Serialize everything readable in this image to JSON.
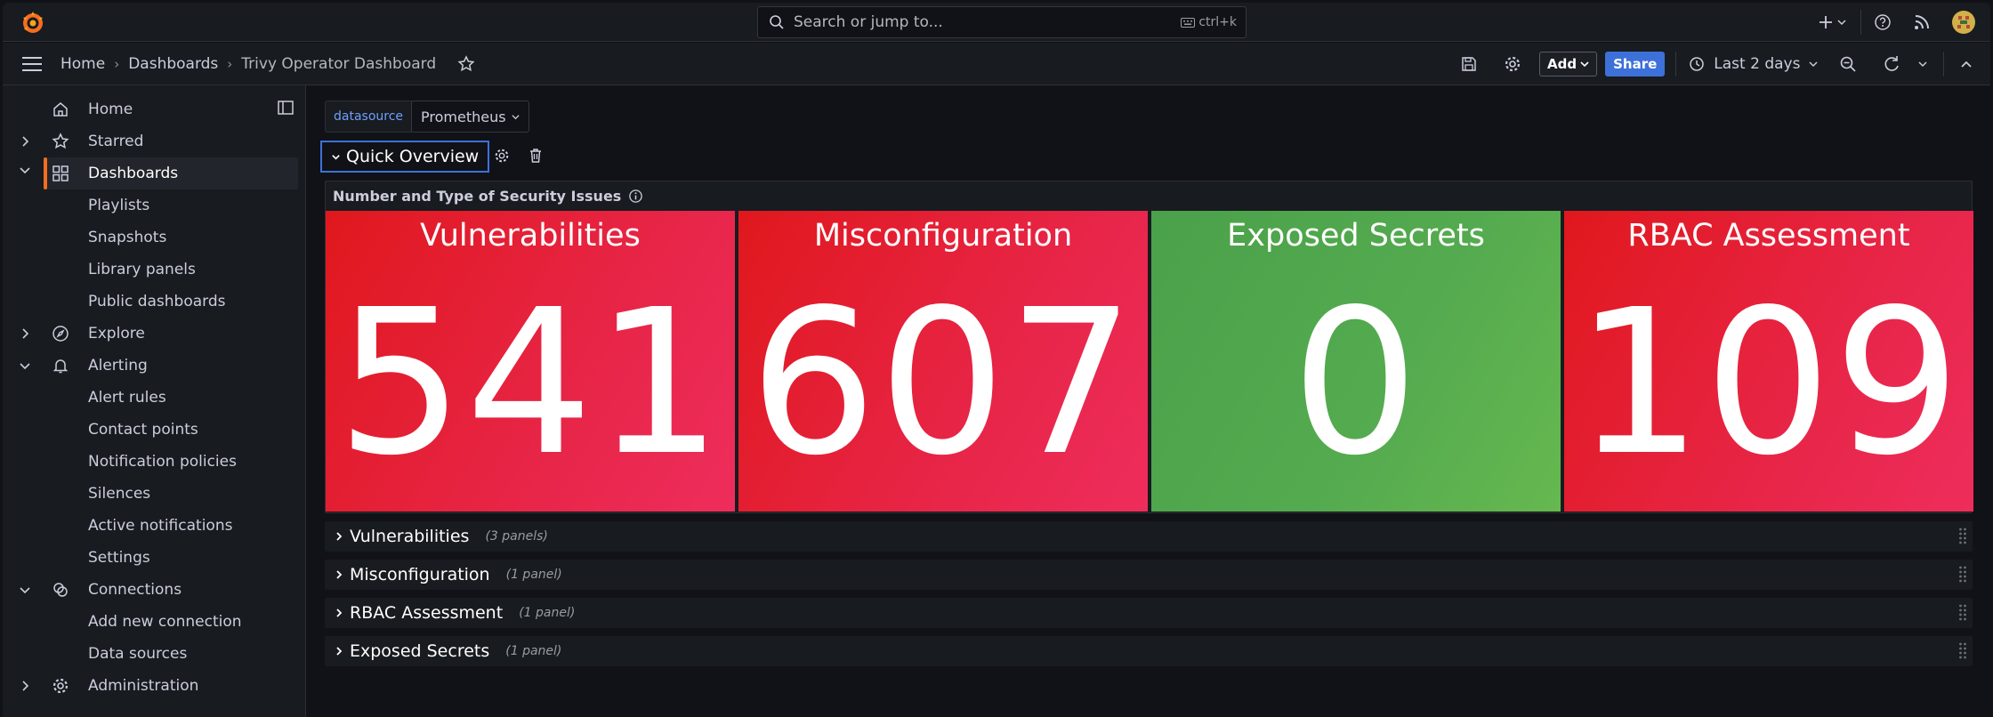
{
  "search": {
    "placeholder": "Search or jump to...",
    "shortcut": "ctrl+k"
  },
  "breadcrumb": [
    "Home",
    "Dashboards",
    "Trivy Operator Dashboard"
  ],
  "toolbar": {
    "add_label": "Add",
    "share_label": "Share",
    "time_range": "Last 2 days"
  },
  "sidebar": {
    "items": [
      {
        "label": "Home",
        "icon": "home-icon"
      },
      {
        "label": "Starred",
        "icon": "star-icon"
      },
      {
        "label": "Dashboards",
        "icon": "apps-icon",
        "active": true
      },
      {
        "label": "Playlists"
      },
      {
        "label": "Snapshots"
      },
      {
        "label": "Library panels"
      },
      {
        "label": "Public dashboards"
      },
      {
        "label": "Explore",
        "icon": "compass-icon"
      },
      {
        "label": "Alerting",
        "icon": "bell-icon"
      },
      {
        "label": "Alert rules"
      },
      {
        "label": "Contact points"
      },
      {
        "label": "Notification policies"
      },
      {
        "label": "Silences"
      },
      {
        "label": "Active notifications"
      },
      {
        "label": "Settings"
      },
      {
        "label": "Connections",
        "icon": "connections-icon"
      },
      {
        "label": "Add new connection"
      },
      {
        "label": "Data sources"
      },
      {
        "label": "Administration",
        "icon": "cog-icon"
      }
    ]
  },
  "variables": {
    "label": "datasource",
    "value": "Prometheus"
  },
  "row": {
    "title": "Quick Overview"
  },
  "panel": {
    "title": "Number and Type of Security Issues",
    "stats": [
      {
        "title": "Vulnerabilities",
        "value": "541",
        "color": "#e0181d"
      },
      {
        "title": "Misconfiguration",
        "value": "607",
        "color": "#e0181d"
      },
      {
        "title": "Exposed Secrets",
        "value": "0",
        "color": "#56a64b"
      },
      {
        "title": "RBAC Assessment",
        "value": "109",
        "color": "#e0181d"
      }
    ]
  },
  "collapsed_rows": [
    {
      "title": "Vulnerabilities",
      "count": "(3 panels)"
    },
    {
      "title": "Misconfiguration",
      "count": "(1 panel)"
    },
    {
      "title": "RBAC Assessment",
      "count": "(1 panel)"
    },
    {
      "title": "Exposed Secrets",
      "count": "(1 panel)"
    }
  ]
}
